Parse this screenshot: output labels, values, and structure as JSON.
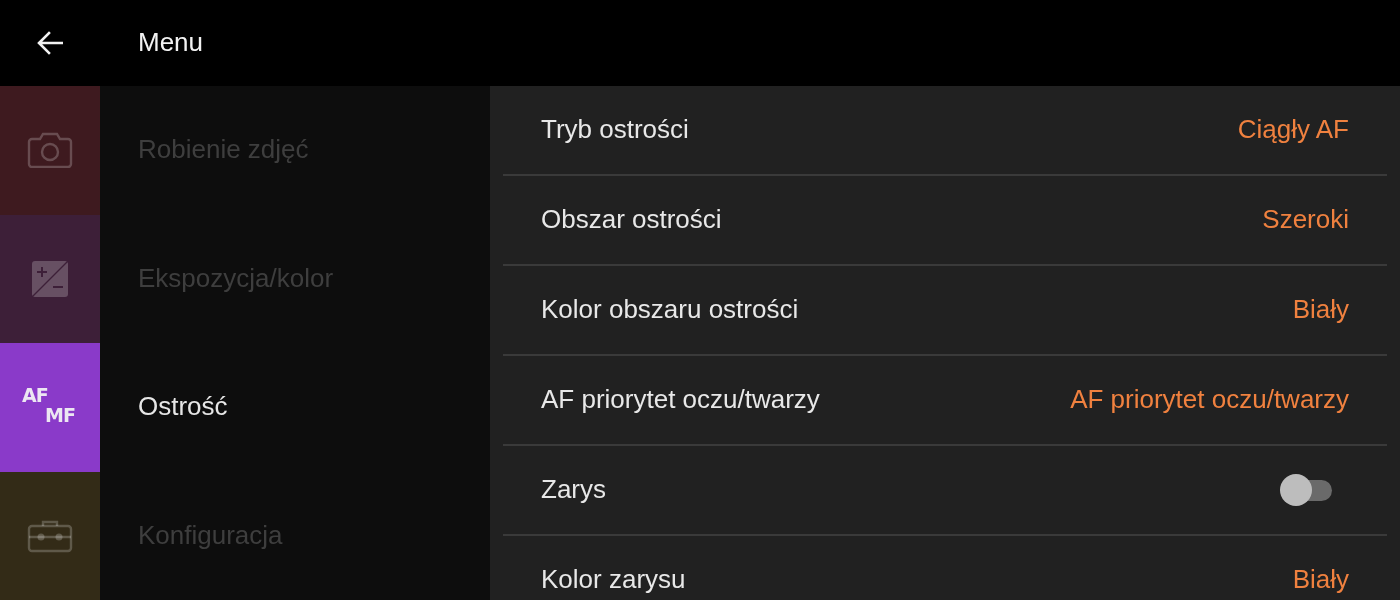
{
  "header": {
    "title": "Menu"
  },
  "categories": [
    {
      "kind": "camera",
      "label": "Robienie zdjęć",
      "color": "#3e1a1f",
      "selected": false
    },
    {
      "kind": "exposure",
      "label": "Ekspozycja/kolor",
      "color": "#3d1f38",
      "selected": false
    },
    {
      "kind": "focus",
      "label": "Ostrość",
      "color": "#8a3ac9",
      "selected": true,
      "icon_text": [
        "AF",
        "MF"
      ]
    },
    {
      "kind": "setup",
      "label": "Konfiguracja",
      "color": "#332b17",
      "selected": false
    }
  ],
  "settings": [
    {
      "kind": "value",
      "label": "Tryb ostrości",
      "value": "Ciągły AF"
    },
    {
      "kind": "value",
      "label": "Obszar ostrości",
      "value": "Szeroki"
    },
    {
      "kind": "value",
      "label": "Kolor obszaru ostrości",
      "value": "Biały"
    },
    {
      "kind": "value",
      "label": "AF priorytet oczu/twarzy",
      "value": "AF priorytet oczu/twarzy"
    },
    {
      "kind": "toggle",
      "label": "Zarys",
      "on": false
    },
    {
      "kind": "value",
      "label": "Kolor zarysu",
      "value": "Biały"
    }
  ]
}
